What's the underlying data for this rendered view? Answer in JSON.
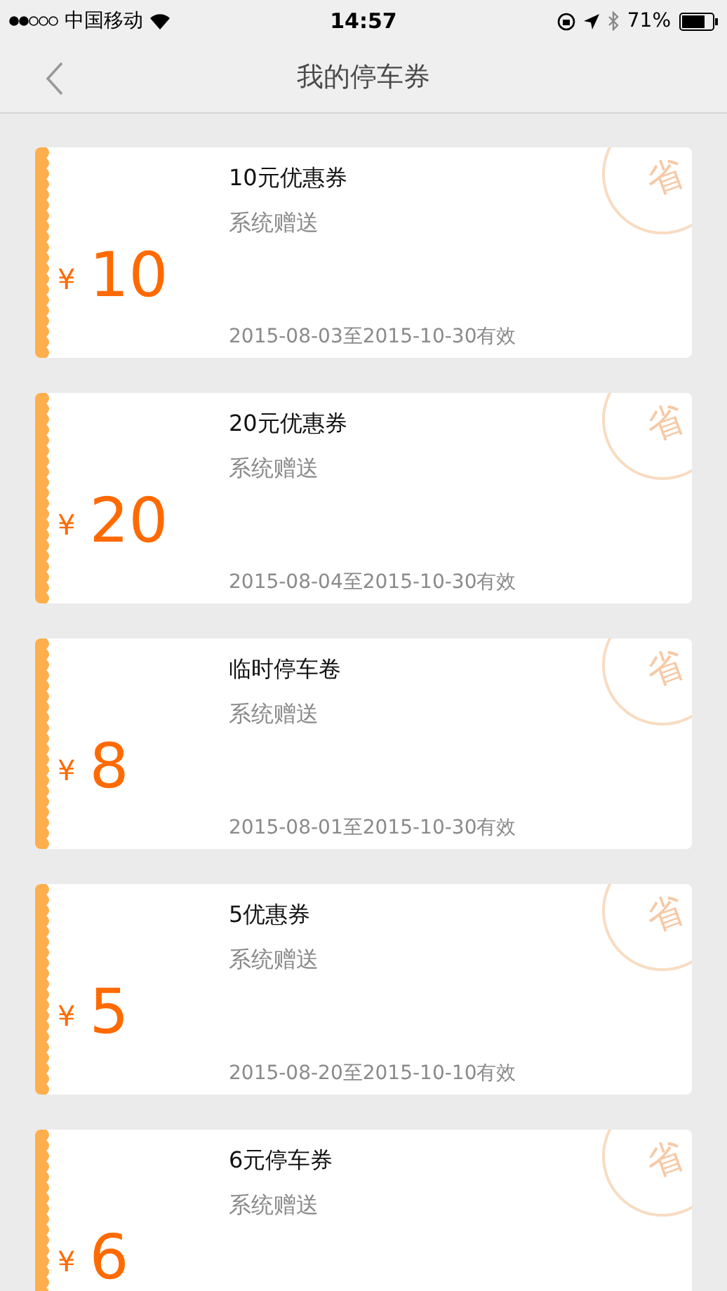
{
  "status_bar": {
    "carrier": "中国移动",
    "time": "14:57",
    "battery": "71%"
  },
  "nav": {
    "title": "我的停车券"
  },
  "coupons": [
    {
      "currency": "¥",
      "amount": "10",
      "title": "10元优惠券",
      "source": "系统赠送",
      "validity": "2015-08-03至2015-10-30有效",
      "stamp": "省"
    },
    {
      "currency": "¥",
      "amount": "20",
      "title": "20元优惠券",
      "source": "系统赠送",
      "validity": "2015-08-04至2015-10-30有效",
      "stamp": "省"
    },
    {
      "currency": "¥",
      "amount": "8",
      "title": "临时停车卷",
      "source": "系统赠送",
      "validity": "2015-08-01至2015-10-30有效",
      "stamp": "省"
    },
    {
      "currency": "¥",
      "amount": "5",
      "title": "5优惠券",
      "source": "系统赠送",
      "validity": "2015-08-20至2015-10-10有效",
      "stamp": "省"
    },
    {
      "currency": "¥",
      "amount": "6",
      "title": "6元停车券",
      "source": "系统赠送",
      "stamp": "省"
    }
  ]
}
